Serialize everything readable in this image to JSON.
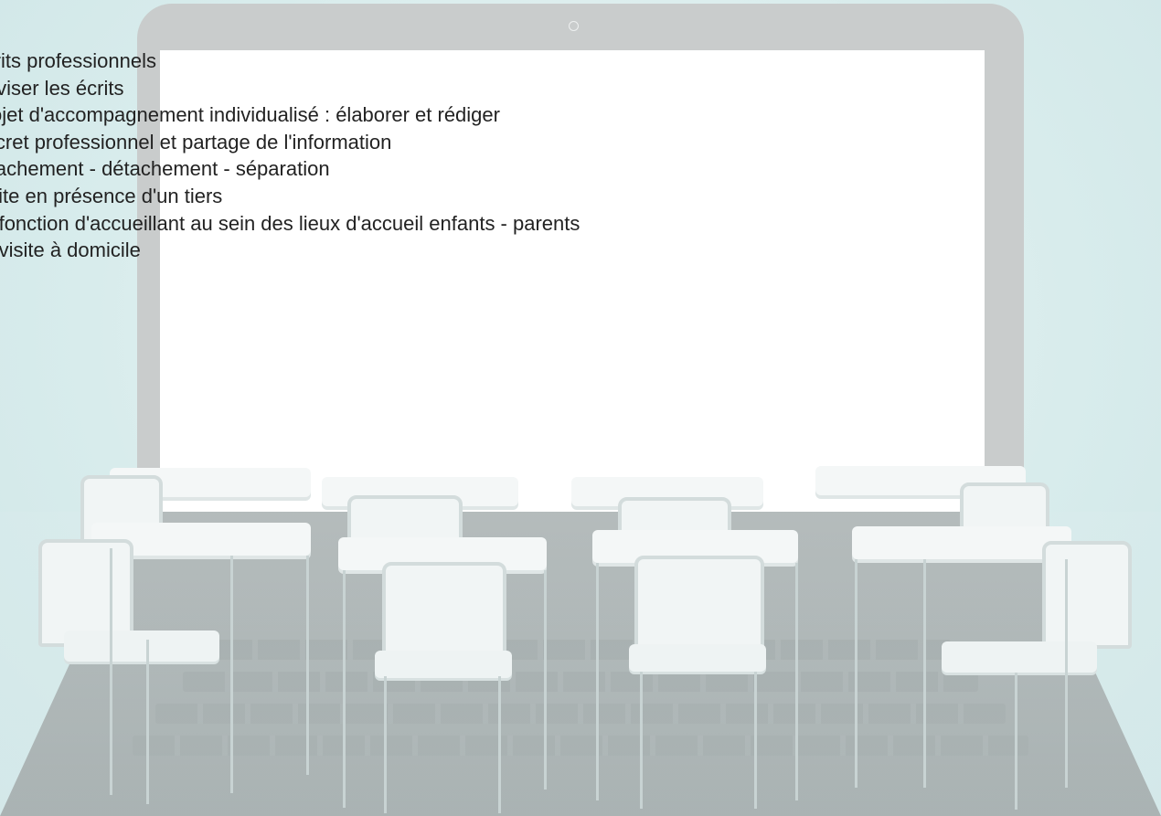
{
  "courses": [
    "Écrits professionnels",
    "Réviser les écrits",
    "Projet d'accompagnement individualisé : élaborer et rédiger",
    "Secret professionnel et partage de l'information",
    "Attachement - détachement - séparation",
    "Visite en présence d'un tiers",
    "La fonction d'accueillant au sein des lieux d'accueil enfants - parents",
    "La visite à domicile"
  ]
}
